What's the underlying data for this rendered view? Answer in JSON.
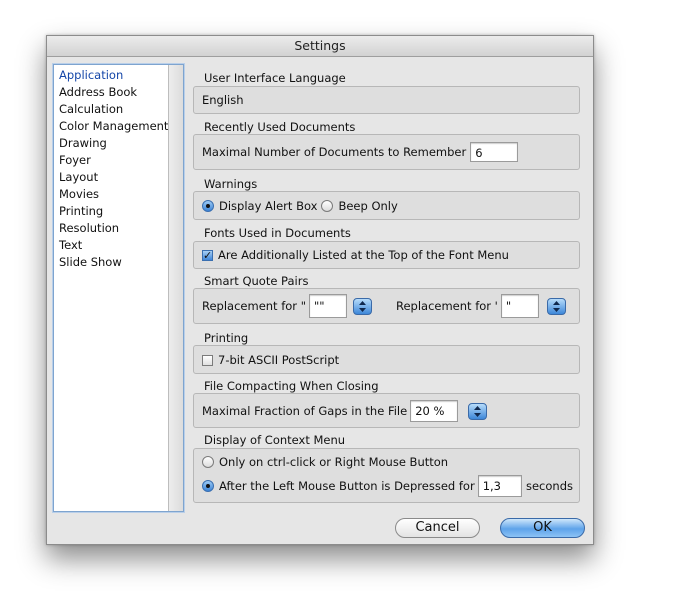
{
  "window": {
    "title": "Settings"
  },
  "sidebar": {
    "items": [
      {
        "label": "Application",
        "selected": true
      },
      {
        "label": "Address Book",
        "selected": false
      },
      {
        "label": "Calculation",
        "selected": false
      },
      {
        "label": "Color Management",
        "selected": false
      },
      {
        "label": "Drawing",
        "selected": false
      },
      {
        "label": "Foyer",
        "selected": false
      },
      {
        "label": "Layout",
        "selected": false
      },
      {
        "label": "Movies",
        "selected": false
      },
      {
        "label": "Printing",
        "selected": false
      },
      {
        "label": "Resolution",
        "selected": false
      },
      {
        "label": "Text",
        "selected": false
      },
      {
        "label": "Slide Show",
        "selected": false
      }
    ]
  },
  "ui_language": {
    "label": "User Interface Language",
    "value": "English"
  },
  "recent_docs": {
    "label": "Recently Used Documents",
    "field_label": "Maximal Number of Documents to Remember",
    "value": "6"
  },
  "warnings": {
    "label": "Warnings",
    "option_alert": "Display Alert Box",
    "option_beep": "Beep Only",
    "selected": "alert"
  },
  "fonts": {
    "label": "Fonts Used in Documents",
    "checkbox_label": "Are Additionally Listed at the Top of the Font Menu",
    "checked": true
  },
  "smart_quotes": {
    "label": "Smart Quote Pairs",
    "double_label": "Replacement for \"",
    "double_value": "\"\"",
    "single_label": "Replacement for '",
    "single_value": "\""
  },
  "printing": {
    "label": "Printing",
    "checkbox_label": "7-bit ASCII PostScript",
    "checked": false
  },
  "compacting": {
    "label": "File Compacting When Closing",
    "field_label": "Maximal Fraction of Gaps in the File",
    "value": "20 %"
  },
  "context_menu": {
    "label": "Display of Context Menu",
    "option_ctrl": "Only on ctrl-click or Right Mouse Button",
    "option_left": "After the Left Mouse Button is Depressed for",
    "seconds_value": "1,3",
    "seconds_unit": "seconds",
    "selected": "left"
  },
  "buttons": {
    "cancel": "Cancel",
    "ok": "OK"
  },
  "colors": {
    "accent": "#3d87d9",
    "selection_text": "#1446a8",
    "panel": "#dedede"
  },
  "icons": {
    "stepper": "stepper-arrows-icon",
    "check": "checkmark-icon"
  }
}
